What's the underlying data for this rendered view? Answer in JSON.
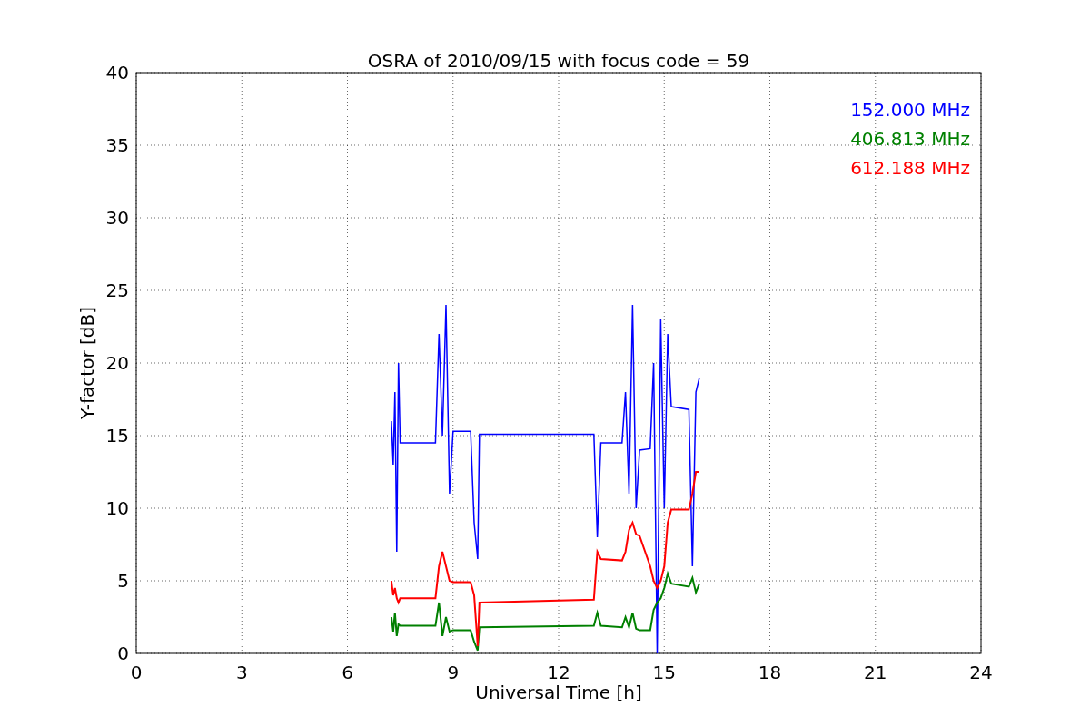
{
  "chart_data": {
    "type": "line",
    "title": "OSRA of 2010/09/15 with focus code = 59",
    "xlabel": "Universal Time [h]",
    "ylabel": "Y-factor [dB]",
    "x": [
      7.25,
      7.3,
      7.35,
      7.4,
      7.45,
      7.5,
      8.5,
      8.6,
      8.7,
      8.8,
      8.9,
      9.0,
      9.5,
      9.6,
      9.7,
      9.75,
      13.0,
      13.1,
      13.2,
      13.8,
      13.9,
      14.0,
      14.1,
      14.2,
      14.3,
      14.6,
      14.7,
      14.8,
      14.9,
      15.0,
      15.1,
      15.2,
      15.7,
      15.8,
      15.9,
      16.0
    ],
    "series": [
      {
        "name": "152.000 MHz",
        "color": "#0000ff",
        "values": [
          16,
          13,
          18,
          7,
          20,
          14.5,
          14.5,
          22,
          15,
          24,
          11,
          15.3,
          15.3,
          9,
          6.5,
          15.1,
          15.1,
          8,
          14.5,
          14.5,
          18,
          11,
          24,
          10,
          14,
          14.1,
          20,
          0,
          23,
          10,
          22,
          17,
          16.8,
          6,
          18,
          19
        ]
      },
      {
        "name": "406.813 MHz",
        "color": "#008000",
        "values": [
          2.5,
          1.5,
          2.8,
          1.2,
          2,
          1.9,
          1.9,
          3.5,
          1.2,
          2.5,
          1.5,
          1.6,
          1.6,
          0.8,
          0.2,
          1.8,
          1.9,
          2.8,
          1.9,
          1.8,
          2.5,
          1.8,
          2.8,
          1.7,
          1.6,
          1.6,
          3,
          3.5,
          3.8,
          4.5,
          5.5,
          4.8,
          4.6,
          5.2,
          4.2,
          4.8
        ]
      },
      {
        "name": "612.188 MHz",
        "color": "#ff0000",
        "values": [
          5,
          4,
          4.5,
          3.8,
          3.5,
          3.8,
          3.8,
          6,
          7,
          6,
          5,
          4.9,
          4.9,
          4,
          0.5,
          3.5,
          3.7,
          7,
          6.5,
          6.4,
          7,
          8.5,
          9,
          8.2,
          8.1,
          6,
          5,
          4.5,
          5,
          6,
          9,
          9.9,
          9.9,
          11,
          12.5,
          12.5
        ]
      }
    ],
    "grid": true,
    "xlim": [
      0,
      24
    ],
    "ylim": [
      0,
      40
    ],
    "xticks": [
      0,
      3,
      6,
      9,
      12,
      15,
      18,
      21,
      24
    ],
    "yticks": [
      0,
      5,
      10,
      15,
      20,
      25,
      30,
      35,
      40
    ]
  }
}
